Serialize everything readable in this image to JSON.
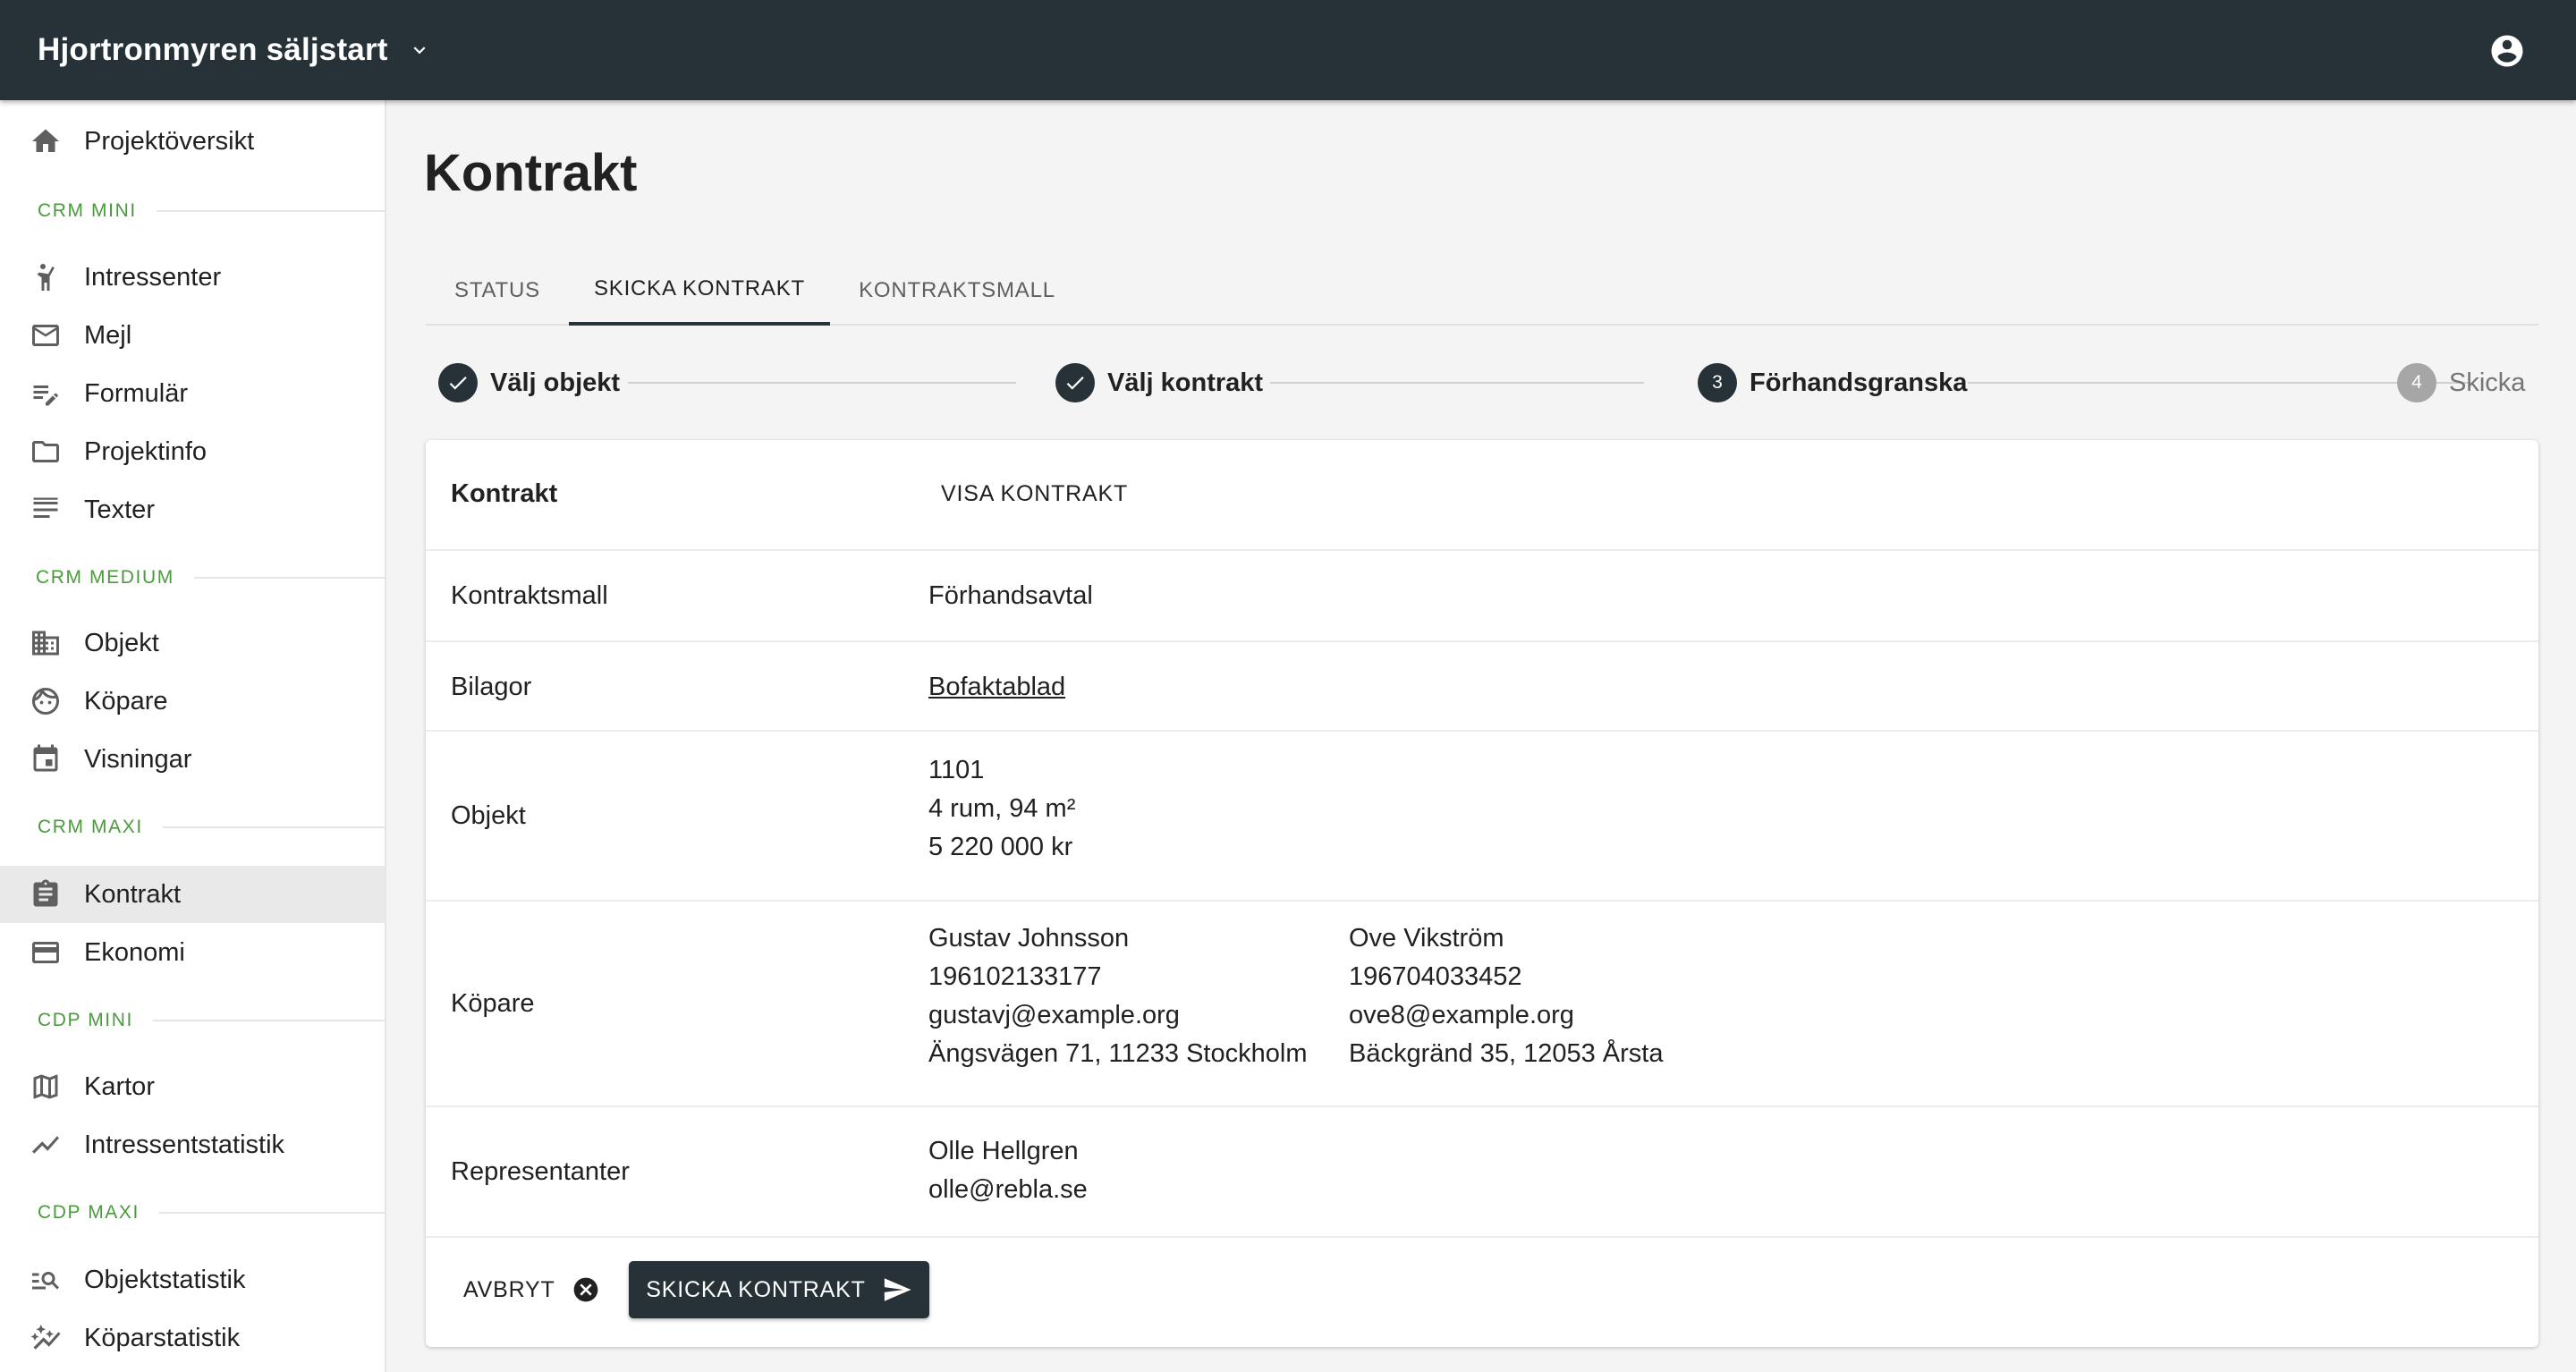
{
  "appbar": {
    "project": "Hjortronmyren säljstart"
  },
  "sidebar": {
    "top_item": "Projektöversikt",
    "sections": {
      "crm_mini": "CRM MINI",
      "crm_medium": "CRM MEDIUM",
      "crm_maxi": "CRM MAXI",
      "cdp_mini": "CDP MINI",
      "cdp_maxi": "CDP MAXI"
    },
    "items": {
      "intressenter": "Intressenter",
      "mejl": "Mejl",
      "formular": "Formulär",
      "projektinfo": "Projektinfo",
      "texter": "Texter",
      "objekt": "Objekt",
      "kopare": "Köpare",
      "visningar": "Visningar",
      "kontrakt": "Kontrakt",
      "ekonomi": "Ekonomi",
      "kartor": "Kartor",
      "intressentstatistik": "Intressentstatistik",
      "objektstatistik": "Objektstatistik",
      "koparstatistik": "Köparstatistik"
    },
    "active": "Kontrakt"
  },
  "page": {
    "title": "Kontrakt"
  },
  "tabs": [
    {
      "label": "STATUS"
    },
    {
      "label": "SKICKA KONTRAKT"
    },
    {
      "label": "KONTRAKTSMALL"
    }
  ],
  "active_tab": "SKICKA KONTRAKT",
  "stepper": [
    {
      "label": "Välj objekt",
      "state": "done"
    },
    {
      "label": "Välj kontrakt",
      "state": "done"
    },
    {
      "number": "3",
      "label": "Förhandsgranska",
      "state": "active"
    },
    {
      "number": "4",
      "label": "Skicka",
      "state": "pending"
    }
  ],
  "summary": {
    "header": {
      "label": "Kontrakt",
      "action": "VISA KONTRAKT"
    },
    "template": {
      "label": "Kontraktsmall",
      "value": "Förhandsavtal"
    },
    "attachments": {
      "label": "Bilagor",
      "value": "Bofaktablad"
    },
    "object": {
      "label": "Objekt",
      "number": "1101",
      "size": "4 rum, 94 m²",
      "price": "5 220 000 kr"
    },
    "buyers": {
      "label": "Köpare",
      "list": [
        {
          "name": "Gustav Johnsson",
          "id": "196102133177",
          "email": "gustavj@example.org",
          "address": "Ängsvägen 71, 11233 Stockholm"
        },
        {
          "name": "Ove Vikström",
          "id": "196704033452",
          "email": "ove8@example.org",
          "address": "Bäckgränd 35, 12053 Årsta"
        }
      ]
    },
    "representatives": {
      "label": "Representanter",
      "name": "Olle Hellgren",
      "email": "olle@rebla.se"
    }
  },
  "actions": {
    "cancel": "AVBRYT",
    "send": "SKICKA KONTRAKT"
  }
}
